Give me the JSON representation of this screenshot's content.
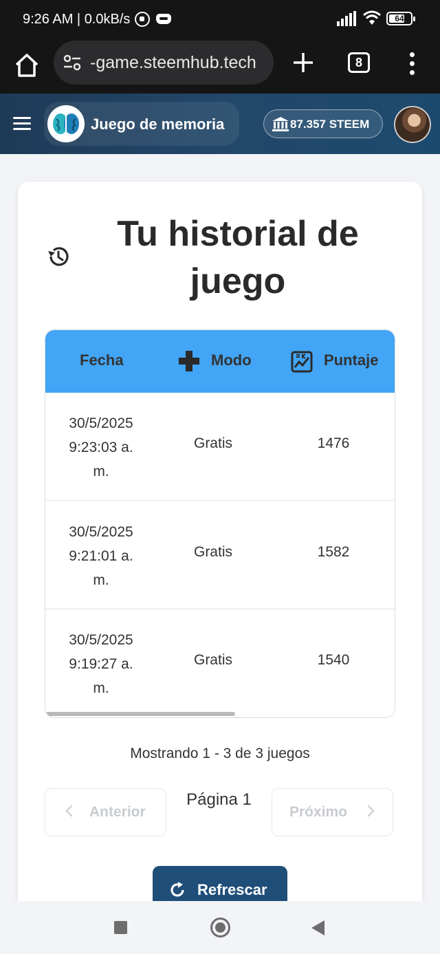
{
  "status_bar": {
    "time": "9:26 AM | 0.0kB/s",
    "battery": "64",
    "icons": [
      "whatsapp-icon",
      "discord-icon",
      "signal-icon",
      "wifi-icon",
      "battery-icon"
    ]
  },
  "browser": {
    "url": "-game.steemhub.tech",
    "tab_count": "8",
    "icons": [
      "home-icon",
      "site-settings-icon",
      "plus-icon",
      "tabs-icon",
      "more-vert-icon"
    ]
  },
  "app_header": {
    "title": "Juego de memoria",
    "balance": "87.357 STEEM",
    "icons": [
      "menu-icon",
      "brain-logo-icon",
      "bank-icon",
      "avatar"
    ]
  },
  "history": {
    "title": "Tu historial de juego",
    "columns": {
      "date": "Fecha",
      "mode": "Modo",
      "score": "Puntaje"
    },
    "rows": [
      {
        "date": "30/5/2025 9:23:03 a. m.",
        "mode": "Gratis",
        "score": "1476"
      },
      {
        "date": "30/5/2025 9:21:01 a. m.",
        "mode": "Gratis",
        "score": "1582"
      },
      {
        "date": "30/5/2025 9:19:27 a. m.",
        "mode": "Gratis",
        "score": "1540"
      }
    ],
    "showing": "Mostrando 1 - 3 de 3 juegos",
    "pagination": {
      "prev_label": "Anterior",
      "next_label": "Próximo",
      "page_label": "Página 1"
    },
    "refresh_label": "Refrescar"
  },
  "colors": {
    "header_bg": "#1f3a57",
    "table_header": "#42a5f5",
    "refresh_button": "#1f4e79"
  }
}
